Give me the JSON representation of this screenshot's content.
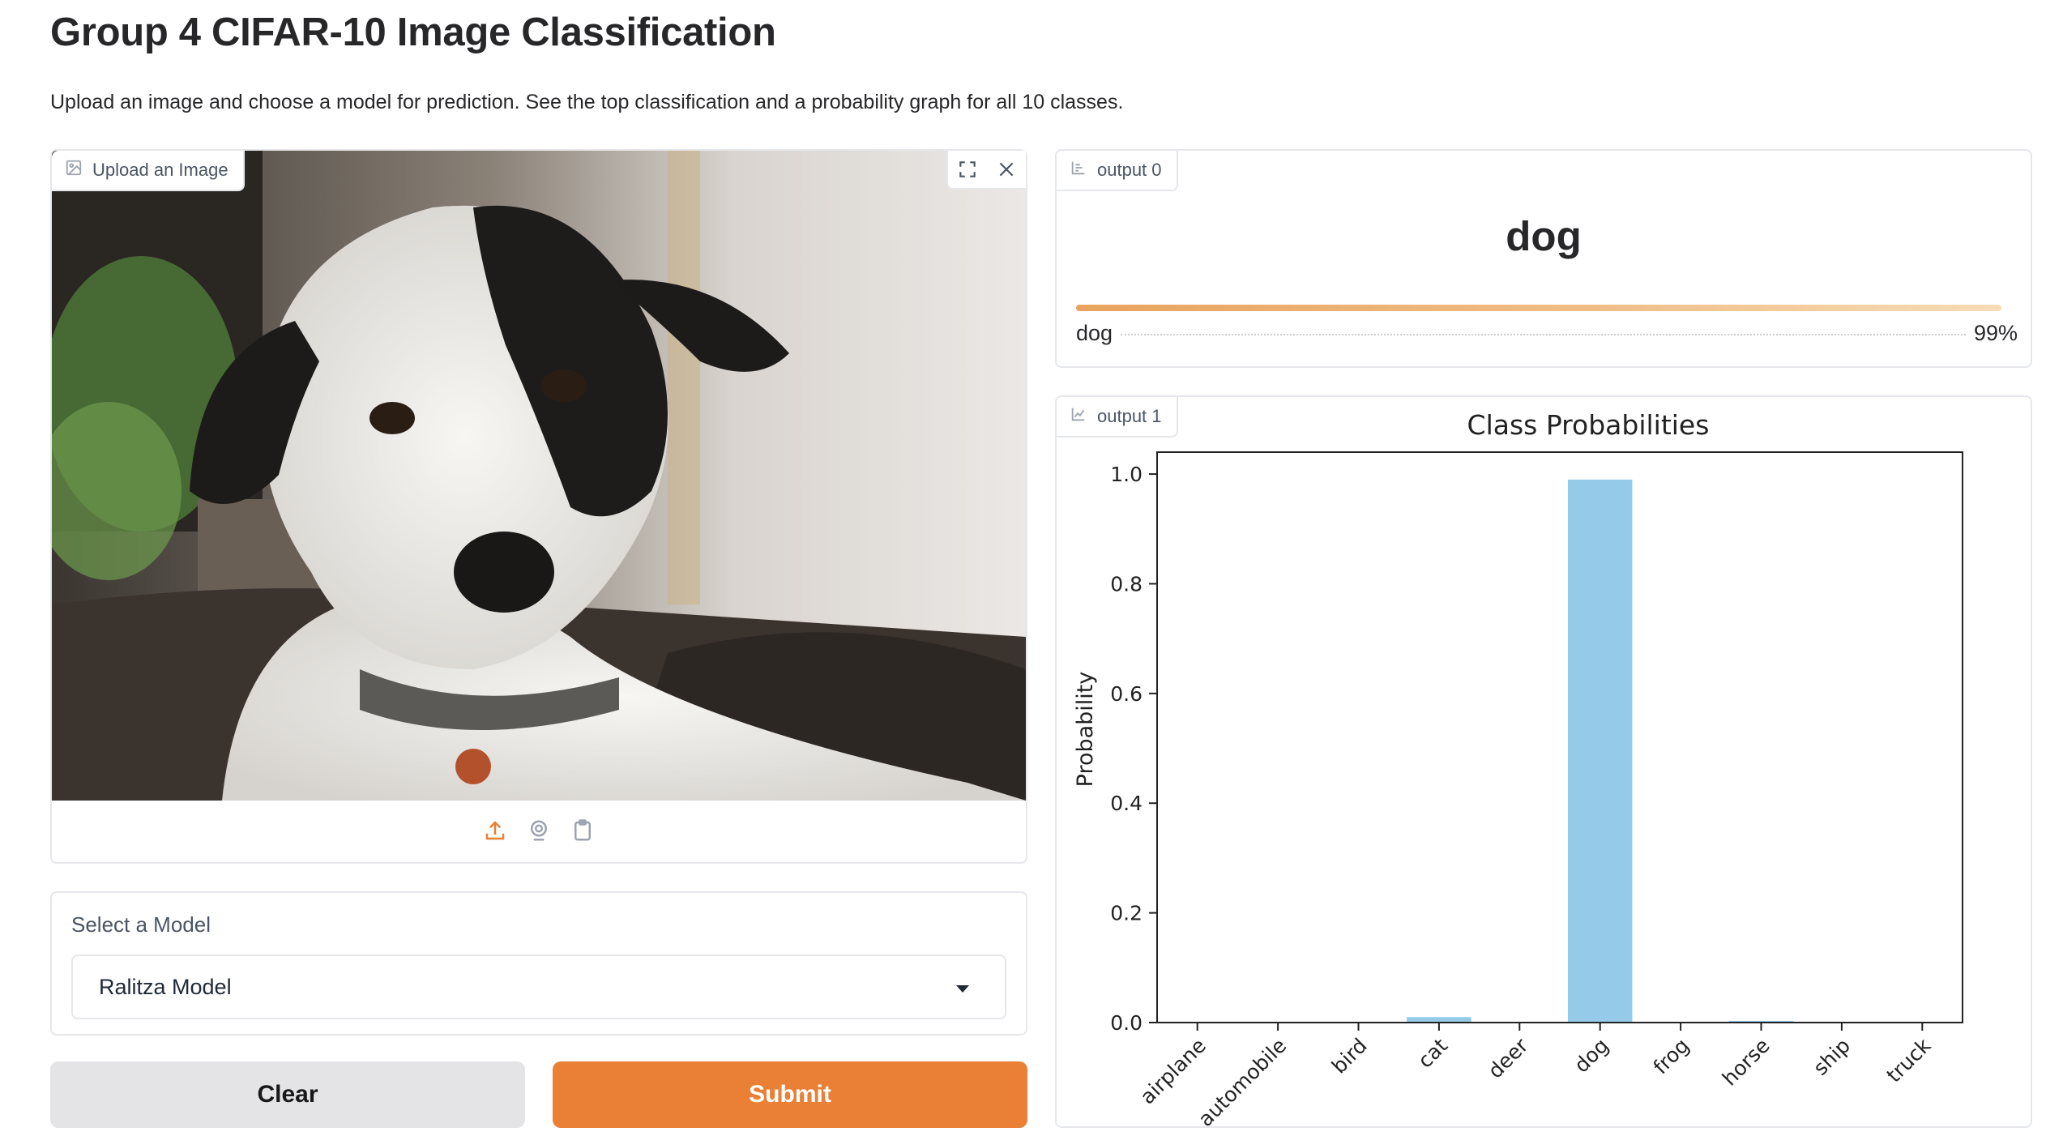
{
  "header": {
    "title": "Group 4 CIFAR-10 Image Classification",
    "description": "Upload an image and choose a model for prediction. See the top classification and a probability graph for all 10 classes."
  },
  "image_input": {
    "label": "Upload an Image",
    "tools": [
      "fullscreen-icon",
      "close-icon"
    ],
    "sources": [
      "upload-icon",
      "webcam-icon",
      "clipboard-icon"
    ],
    "accent": "#ea7f36"
  },
  "model_select": {
    "label": "Select a Model",
    "value": "Ralitza Model"
  },
  "buttons": {
    "clear": "Clear",
    "submit": "Submit"
  },
  "output0": {
    "label": "output 0",
    "top_class": "dog",
    "confidences": [
      {
        "label": "dog",
        "percent": "99%",
        "value": 0.99
      }
    ]
  },
  "output1": {
    "label": "output 1"
  },
  "chart_data": {
    "type": "bar",
    "title": "Class Probabilities",
    "xlabel": "",
    "ylabel": "Probability",
    "categories": [
      "airplane",
      "automobile",
      "bird",
      "cat",
      "deer",
      "dog",
      "frog",
      "horse",
      "ship",
      "truck"
    ],
    "values": [
      0.0,
      0.0,
      0.0,
      0.01,
      0.0,
      0.99,
      0.0,
      0.003,
      0.0,
      0.0
    ],
    "ylim": [
      0,
      1.04
    ],
    "yticks": [
      "0.0",
      "0.2",
      "0.4",
      "0.6",
      "0.8",
      "1.0"
    ],
    "bar_color": "#95cae8",
    "grid": false
  }
}
